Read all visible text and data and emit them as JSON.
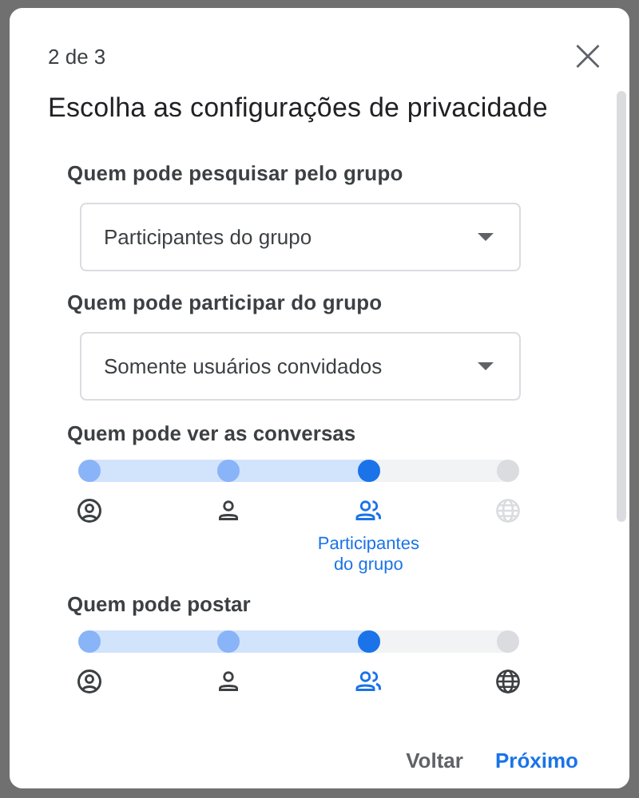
{
  "dialog": {
    "step": "2 de 3",
    "title": "Escolha as configurações de privacidade",
    "close_label": "×"
  },
  "dropdowns": [
    {
      "label": "Quem pode pesquisar pelo grupo",
      "value": "Participantes do grupo"
    },
    {
      "label": "Quem pode participar do grupo",
      "value": "Somente usuários convidados"
    }
  ],
  "sliders": [
    {
      "label": "Quem pode ver as conversas",
      "level": 0.667,
      "options": [
        {
          "kind": "person-circle",
          "selected": false,
          "disabled": false
        },
        {
          "kind": "person",
          "selected": false,
          "disabled": false
        },
        {
          "kind": "group",
          "selected": true,
          "disabled": false,
          "caption": "Participantes do grupo"
        },
        {
          "kind": "globe",
          "selected": false,
          "disabled": true
        }
      ]
    },
    {
      "label": "Quem pode postar",
      "level": 0.667,
      "options": [
        {
          "kind": "person-circle",
          "selected": false,
          "disabled": false
        },
        {
          "kind": "person",
          "selected": false,
          "disabled": false
        },
        {
          "kind": "group",
          "selected": true,
          "disabled": false
        },
        {
          "kind": "globe",
          "selected": false,
          "disabled": false
        }
      ]
    }
  ],
  "buttons": [
    {
      "label": "Voltar",
      "kind": "secondary"
    },
    {
      "label": "Próximo",
      "kind": "primary"
    }
  ]
}
